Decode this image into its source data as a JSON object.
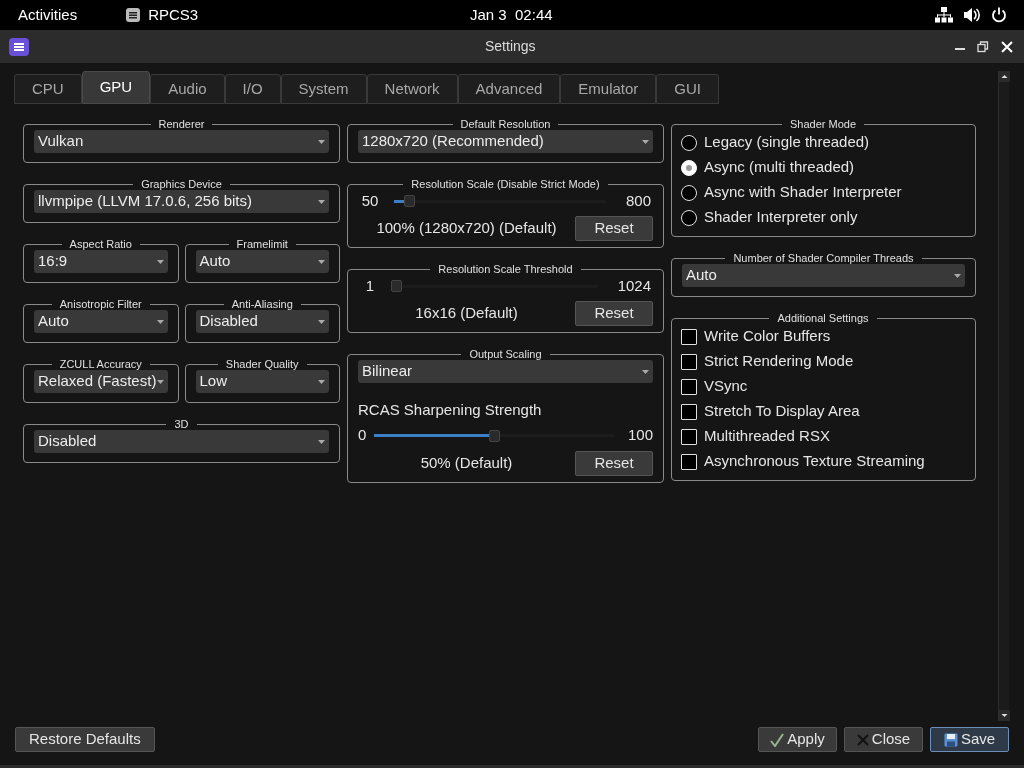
{
  "top_bar": {
    "activities": "Activities",
    "app": "RPCS3",
    "clock": "Jan 3  02:44"
  },
  "window": {
    "title": "Settings"
  },
  "tabs": [
    {
      "label": "CPU",
      "selected": false
    },
    {
      "label": "GPU",
      "selected": true
    },
    {
      "label": "Audio",
      "selected": false
    },
    {
      "label": "I/O",
      "selected": false
    },
    {
      "label": "System",
      "selected": false
    },
    {
      "label": "Network",
      "selected": false
    },
    {
      "label": "Advanced",
      "selected": false
    },
    {
      "label": "Emulator",
      "selected": false
    },
    {
      "label": "GUI",
      "selected": false
    }
  ],
  "left_column": [
    {
      "groups": [
        {
          "title": "Renderer",
          "value": "Vulkan"
        }
      ]
    },
    {
      "groups": [
        {
          "title": "Graphics Device",
          "value": "llvmpipe (LLVM 17.0.6, 256 bits)"
        }
      ]
    },
    {
      "groups": [
        {
          "title": "Aspect Ratio",
          "value": "16:9"
        },
        {
          "title": "Framelimit",
          "value": "Auto"
        }
      ]
    },
    {
      "groups": [
        {
          "title": "Anisotropic Filter",
          "value": "Auto"
        },
        {
          "title": "Anti-Aliasing",
          "value": "Disabled"
        }
      ]
    },
    {
      "groups": [
        {
          "title": "ZCULL Accuracy",
          "value": "Relaxed (Fastest)"
        },
        {
          "title": "Shader Quality",
          "value": "Low"
        }
      ]
    },
    {
      "groups": [
        {
          "title": "3D",
          "value": "Disabled"
        }
      ]
    }
  ],
  "middle_column": [
    {
      "kind": "dropdown",
      "title": "Default Resolution",
      "value": "1280x720 (Recommended)"
    },
    {
      "kind": "slider",
      "title": "Resolution Scale (Disable Strict Mode)",
      "min": "50",
      "max": "800",
      "level": 0.07,
      "reading": "100% (1280x720) (Default)",
      "button": "Reset"
    },
    {
      "kind": "slider",
      "title": "Resolution Scale Threshold",
      "min": "1",
      "max": "1024",
      "level": 0.01,
      "reading": "16x16 (Default)",
      "button": "Reset"
    },
    {
      "kind": "output_scaling",
      "title": "Output Scaling",
      "value": "Bilinear",
      "sub_label": "RCAS Sharpening Strength",
      "min": "0",
      "max": "100",
      "level": 0.5,
      "reading": "50% (Default)",
      "button": "Reset"
    }
  ],
  "right_column": [
    {
      "kind": "radio_group",
      "title": "Shader Mode",
      "options": [
        {
          "label": "Legacy (single threaded)",
          "selected": false
        },
        {
          "label": "Async (multi threaded)",
          "selected": true
        },
        {
          "label": "Async with Shader Interpreter",
          "selected": false
        },
        {
          "label": "Shader Interpreter only",
          "selected": false
        }
      ]
    },
    {
      "kind": "dropdown",
      "title": "Number of Shader Compiler Threads",
      "value": "Auto"
    },
    {
      "kind": "checkbox_group",
      "title": "Additional Settings",
      "options": [
        {
          "label": "Write Color Buffers",
          "checked": false
        },
        {
          "label": "Strict Rendering Mode",
          "checked": false
        },
        {
          "label": "VSync",
          "checked": false
        },
        {
          "label": "Stretch To Display Area",
          "checked": false
        },
        {
          "label": "Multithreaded RSX",
          "checked": false
        },
        {
          "label": "Asynchronous Texture Streaming",
          "checked": false
        }
      ]
    }
  ],
  "footer": {
    "restore": "Restore Defaults",
    "buttons": [
      {
        "kind": "apply",
        "label": "Apply"
      },
      {
        "kind": "close",
        "label": "Close"
      },
      {
        "kind": "save",
        "label": "Save"
      }
    ]
  }
}
